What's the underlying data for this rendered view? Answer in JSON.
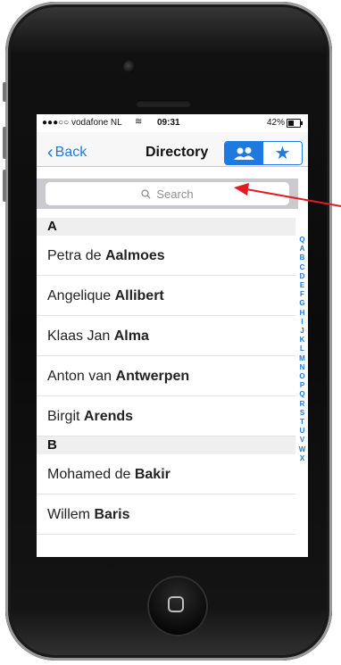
{
  "status": {
    "carrier": "●●●○○ vodafone NL",
    "time": "09:31",
    "battery": "42%"
  },
  "nav": {
    "back_label": "Back",
    "title": "Directory"
  },
  "search": {
    "placeholder": "Search"
  },
  "sections": [
    {
      "letter": "A",
      "rows": [
        {
          "first": "Petra de",
          "last": "Aalmoes"
        },
        {
          "first": "Angelique",
          "last": "Allibert"
        },
        {
          "first": "Klaas Jan",
          "last": "Alma"
        },
        {
          "first": "Anton van",
          "last": "Antwerpen"
        },
        {
          "first": "Birgit",
          "last": "Arends"
        }
      ]
    },
    {
      "letter": "B",
      "rows": [
        {
          "first": "Mohamed de",
          "last": "Bakir"
        },
        {
          "first": "Willem",
          "last": "Baris"
        }
      ]
    }
  ],
  "index_letters": [
    "Q",
    "A",
    "B",
    "C",
    "D",
    "E",
    "F",
    "G",
    "H",
    "I",
    "J",
    "K",
    "L",
    "M",
    "N",
    "O",
    "P",
    "Q",
    "R",
    "S",
    "T",
    "U",
    "V",
    "W",
    "X"
  ],
  "colors": {
    "accent": "#1f7ae0",
    "arrow": "#e11b22"
  }
}
